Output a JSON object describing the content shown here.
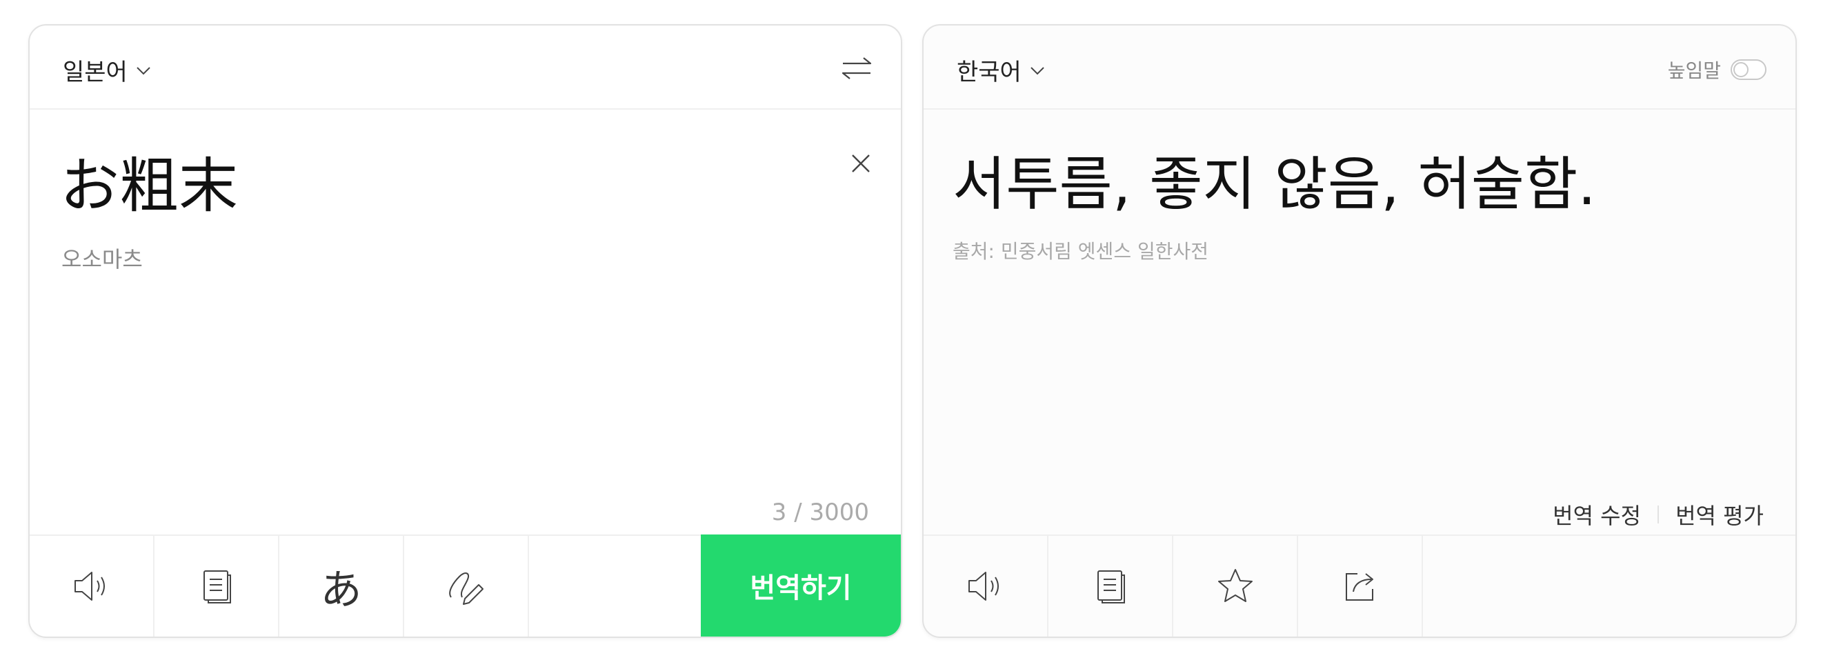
{
  "source": {
    "language": "일본어",
    "text": "お粗末",
    "reading": "오소마츠",
    "char_count": "3 / 3000",
    "translate_label": "번역하기"
  },
  "target": {
    "language": "한국어",
    "honorific_label": "높임말",
    "honorific_enabled": false,
    "text": "서투름, 좋지 않음, 허술함.",
    "source_note": "출처: 민중서림 엣센스 일한사전",
    "edit_label": "번역 수정",
    "rate_label": "번역 평가"
  },
  "icons": {
    "left_toolbar": [
      "speaker-icon",
      "copy-icon",
      "hiragana-icon",
      "handwriting-icon"
    ],
    "right_toolbar": [
      "speaker-icon",
      "copy-icon",
      "star-icon",
      "share-icon"
    ],
    "hiragana_glyph": "あ"
  },
  "colors": {
    "accent": "#23d96e",
    "border": "#e2e2e2",
    "muted_text": "#a8a8a8"
  }
}
